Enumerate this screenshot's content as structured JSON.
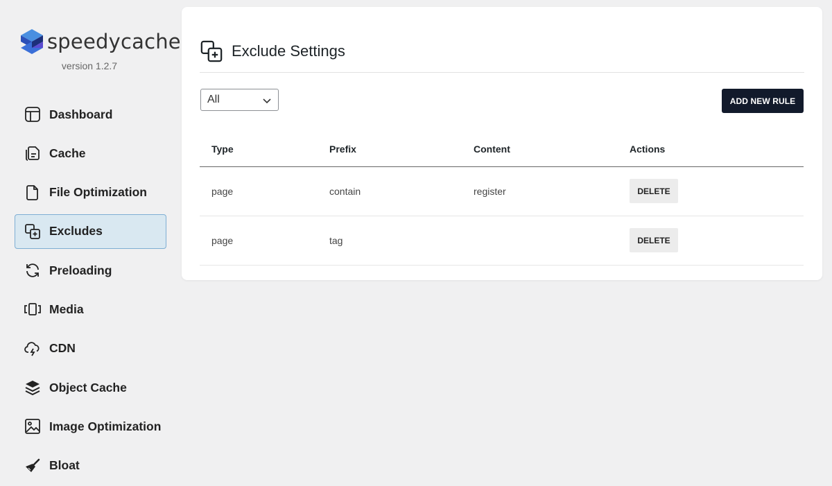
{
  "brand": {
    "name": "speedycache",
    "version": "version 1.2.7"
  },
  "sidebar": {
    "items": [
      {
        "label": "Dashboard",
        "icon": "dashboard-icon",
        "active": false
      },
      {
        "label": "Cache",
        "icon": "cache-icon",
        "active": false
      },
      {
        "label": "File Optimization",
        "icon": "file-icon",
        "active": false
      },
      {
        "label": "Excludes",
        "icon": "excludes-icon",
        "active": true
      },
      {
        "label": "Preloading",
        "icon": "refresh-icon",
        "active": false
      },
      {
        "label": "Media",
        "icon": "media-icon",
        "active": false
      },
      {
        "label": "CDN",
        "icon": "cloud-icon",
        "active": false
      },
      {
        "label": "Object Cache",
        "icon": "layers-icon",
        "active": false
      },
      {
        "label": "Image Optimization",
        "icon": "image-icon",
        "active": false
      },
      {
        "label": "Bloat",
        "icon": "broom-icon",
        "active": false
      }
    ]
  },
  "main": {
    "title": "Exclude Settings",
    "filter": {
      "selected": "All"
    },
    "add_button": "ADD NEW RULE",
    "table": {
      "headers": [
        "Type",
        "Prefix",
        "Content",
        "Actions"
      ],
      "rows": [
        {
          "type": "page",
          "prefix": "contain",
          "content": "register",
          "action": "DELETE"
        },
        {
          "type": "page",
          "prefix": "tag",
          "content": "",
          "action": "DELETE"
        }
      ]
    }
  },
  "colors": {
    "accent_dark": "#121a2b",
    "active_bg": "#d9e8f1",
    "active_border": "#7eaed3",
    "page_bg": "#f0f0f1"
  }
}
